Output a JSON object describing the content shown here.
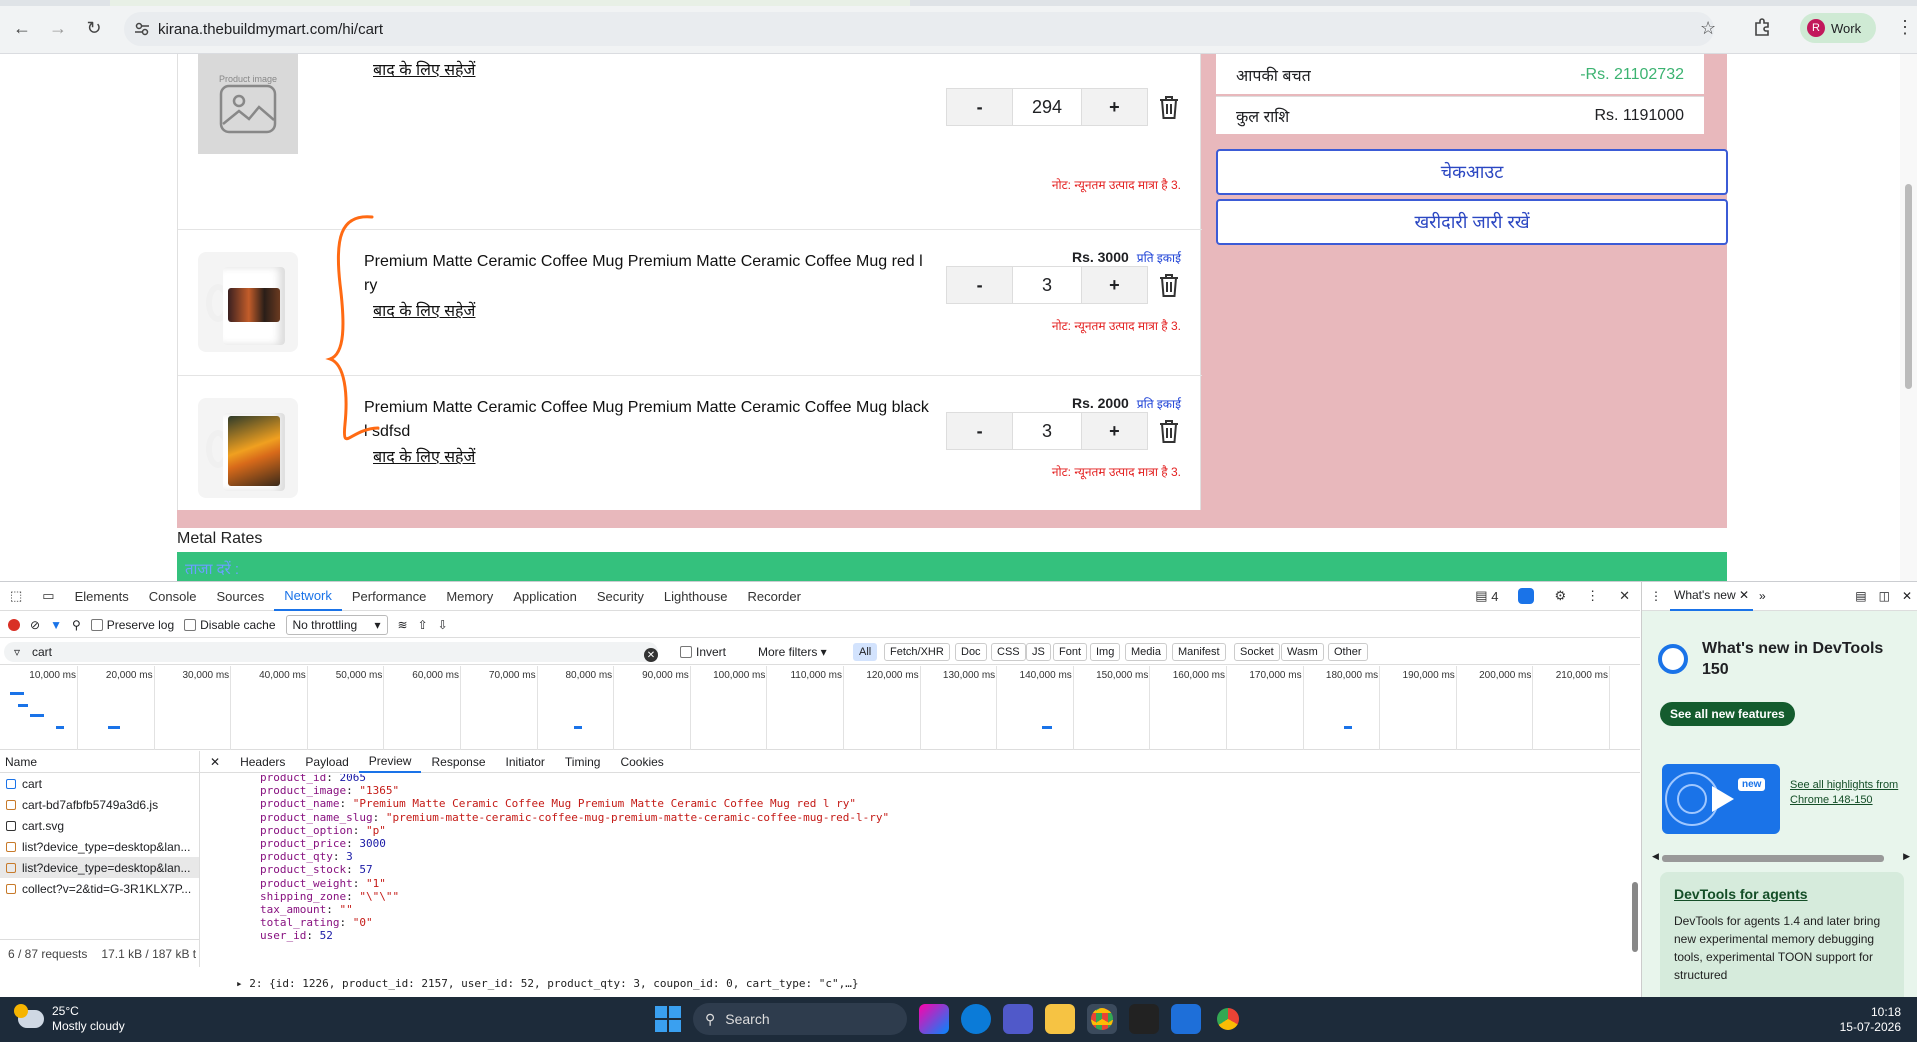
{
  "browser": {
    "url": "kirana.thebuildmymart.com/hi/cart",
    "profile_label": "Work",
    "profile_initial": "R"
  },
  "cart": {
    "save_for_later": "बाद के लिए सहेजें",
    "per_unit": "प्रति इकाई",
    "min_qty_note": "नोट: न्यूनतम उत्पाद मात्रा है 3.",
    "placeholder_label": "Product image",
    "items": [
      {
        "name": "",
        "qty": "294",
        "price": ""
      },
      {
        "name": "Premium Matte Ceramic Coffee Mug Premium Matte Ceramic Coffee Mug red l ry",
        "qty": "3",
        "price": "Rs. 3000"
      },
      {
        "name": "Premium Matte Ceramic Coffee Mug Premium Matte Ceramic Coffee Mug black l sdfsd",
        "qty": "3",
        "price": "Rs. 2000"
      }
    ],
    "minus_label": "-",
    "plus_label": "+"
  },
  "summary": {
    "savings_label": "आपकी बचत",
    "savings_value": "-Rs. 21102732",
    "total_label": "कुल राशि",
    "total_value": "Rs. 1191000",
    "checkout_label": "चेकआउट",
    "continue_label": "खरीदारी जारी रखें"
  },
  "metal_rates": {
    "title": "Metal Rates",
    "bar_text": "ताजा दरें :"
  },
  "devtools": {
    "tabs": [
      "Elements",
      "Console",
      "Sources",
      "Network",
      "Performance",
      "Memory",
      "Application",
      "Security",
      "Lighthouse",
      "Recorder"
    ],
    "active_tab": "Network",
    "issues_count": "4",
    "toolbar": {
      "preserve_log": "Preserve log",
      "disable_cache": "Disable cache",
      "throttling": "No throttling"
    },
    "filter": {
      "value": "cart",
      "invert": "Invert",
      "more_filters": "More filters",
      "types": [
        "All",
        "Fetch/XHR",
        "Doc",
        "CSS",
        "JS",
        "Font",
        "Img",
        "Media",
        "Manifest",
        "Socket",
        "Wasm",
        "Other"
      ]
    },
    "timeline_ticks": [
      "10,000 ms",
      "20,000 ms",
      "30,000 ms",
      "40,000 ms",
      "50,000 ms",
      "60,000 ms",
      "70,000 ms",
      "80,000 ms",
      "90,000 ms",
      "100,000 ms",
      "110,000 ms",
      "120,000 ms",
      "130,000 ms",
      "140,000 ms",
      "150,000 ms",
      "160,000 ms",
      "170,000 ms",
      "180,000 ms",
      "190,000 ms",
      "200,000 ms",
      "210,000 ms"
    ],
    "requests_header": "Name",
    "requests": [
      "cart",
      "cart-bd7afbfb5749a3d6.js",
      "cart.svg",
      "list?device_type=desktop&lan...",
      "list?device_type=desktop&lan...",
      "collect?v=2&tid=G-3R1KLX7P..."
    ],
    "requests_status": "6 / 87 requests",
    "transfer_status": "17.1 kB / 187 kB t",
    "preview_tabs": [
      "Headers",
      "Payload",
      "Preview",
      "Response",
      "Initiator",
      "Timing",
      "Cookies"
    ],
    "active_preview_tab": "Preview",
    "preview_lines": [
      {
        "key": "product_id",
        "val": "2065",
        "type": "n"
      },
      {
        "key": "product_image",
        "val": "\"1365\"",
        "type": "s"
      },
      {
        "key": "product_name",
        "val": "\"Premium Matte Ceramic Coffee Mug Premium Matte Ceramic Coffee Mug red l ry\"",
        "type": "s"
      },
      {
        "key": "product_name_slug",
        "val": "\"premium-matte-ceramic-coffee-mug-premium-matte-ceramic-coffee-mug-red-l-ry\"",
        "type": "s"
      },
      {
        "key": "product_option",
        "val": "\"p\"",
        "type": "s"
      },
      {
        "key": "product_price",
        "val": "3000",
        "type": "n"
      },
      {
        "key": "product_qty",
        "val": "3",
        "type": "n"
      },
      {
        "key": "product_stock",
        "val": "57",
        "type": "n"
      },
      {
        "key": "product_weight",
        "val": "\"1\"",
        "type": "s"
      },
      {
        "key": "shipping_zone",
        "val": "\"\\\"\\\"\"",
        "type": "s"
      },
      {
        "key": "tax_amount",
        "val": "\"\"",
        "type": "s"
      },
      {
        "key": "total_rating",
        "val": "\"0\"",
        "type": "s"
      },
      {
        "key": "user_id",
        "val": "52",
        "type": "n"
      }
    ],
    "preview_collapsed": "▸ 2: {id: 1226, product_id: 2157, user_id: 52, product_qty: 3, coupon_id: 0, cart_type: \"c\",…}"
  },
  "whats_new": {
    "tab_label": "What's new",
    "title": "What's new in DevTools 150",
    "see_all": "See all new features",
    "new_badge": "new",
    "highlights_link": "See all highlights from Chrome 148-150",
    "agents_title": "DevTools for agents",
    "agents_body": "DevTools for agents 1.4 and later bring new experimental memory debugging tools, experimental TOON support for structured"
  },
  "taskbar": {
    "temperature": "25°C",
    "weather": "Mostly cloudy",
    "search_placeholder": "Search",
    "time": "10:18",
    "date": "15-07-2026"
  },
  "colors": {
    "accent_pink": "#e8b8bc",
    "metal_bar_green": "#34c17d",
    "button_border": "#3b5bd6",
    "annotation_orange": "#ff6a13",
    "savings_green": "#3cb371",
    "note_red": "#e32020"
  }
}
